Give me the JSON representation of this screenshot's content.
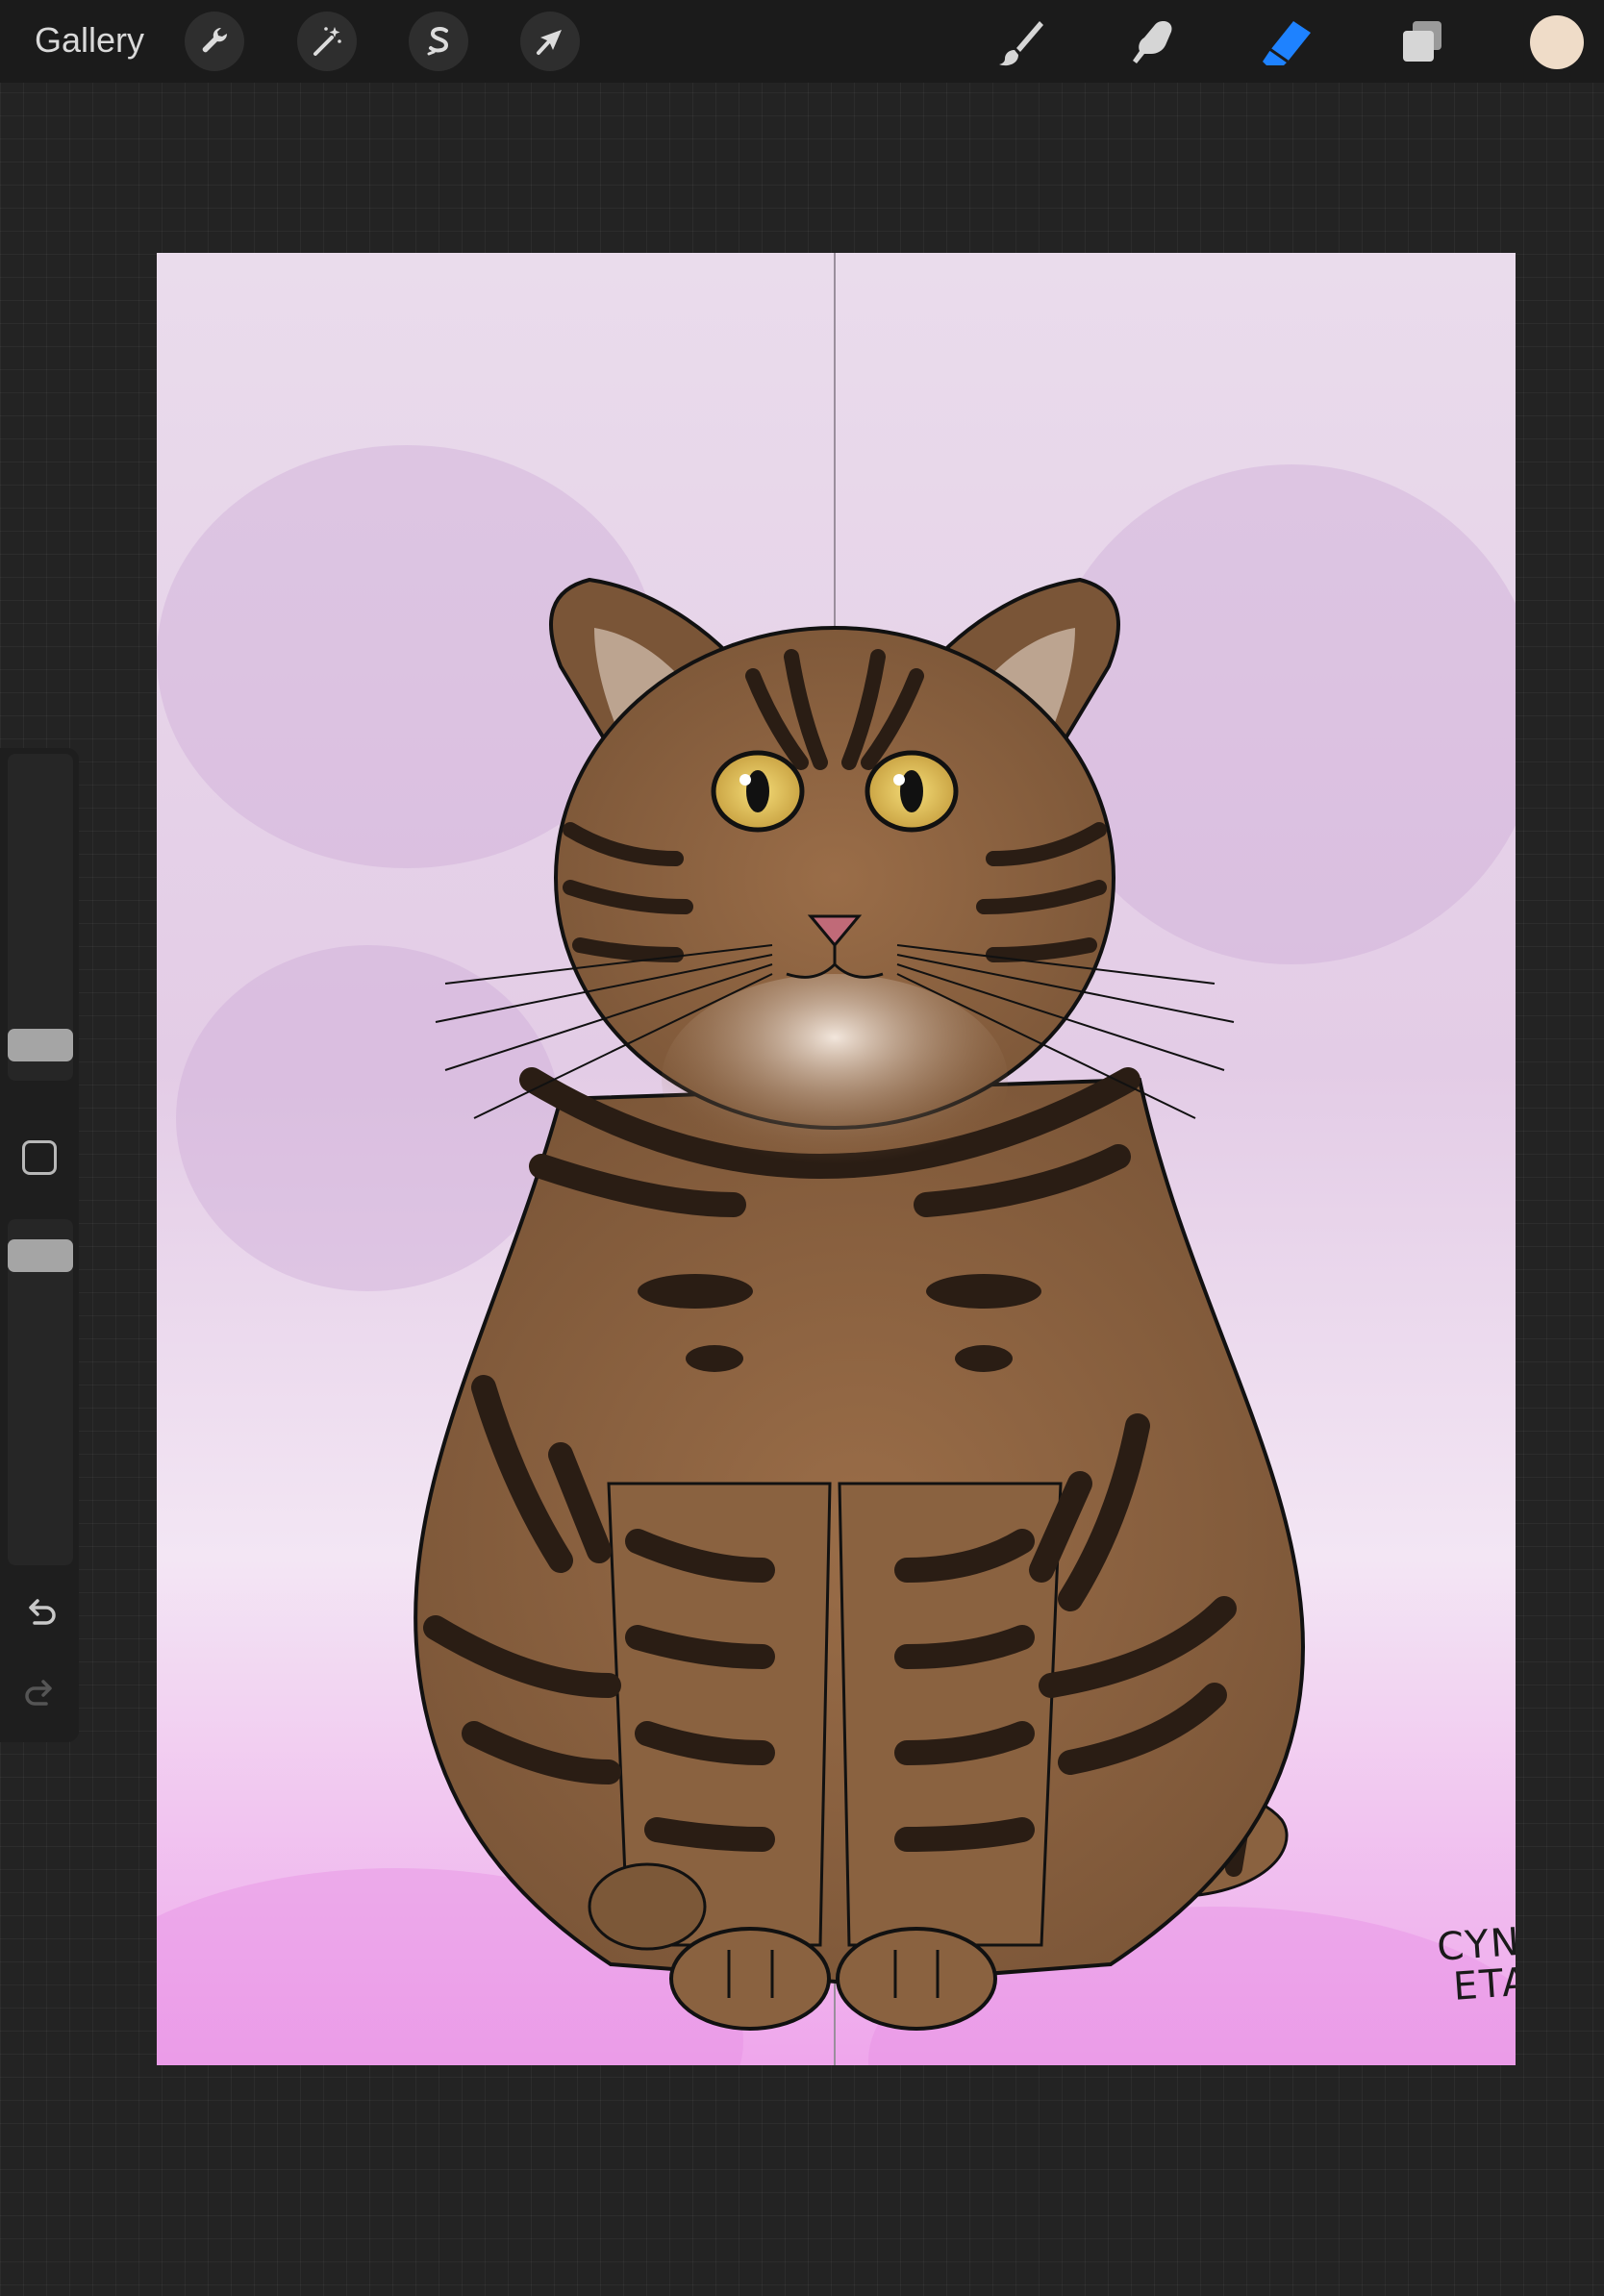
{
  "topbar": {
    "gallery_label": "Gallery",
    "left_tools": [
      {
        "name": "actions",
        "icon": "wrench-icon"
      },
      {
        "name": "adjustments",
        "icon": "magic-wand-icon"
      },
      {
        "name": "selection",
        "icon": "selection-s-icon"
      },
      {
        "name": "transform",
        "icon": "arrow-cursor-icon"
      }
    ],
    "right_tools": [
      {
        "name": "brush",
        "icon": "brush-icon",
        "active": false
      },
      {
        "name": "smudge",
        "icon": "smudge-finger-icon",
        "active": false
      },
      {
        "name": "eraser",
        "icon": "eraser-icon",
        "active": true
      },
      {
        "name": "layers",
        "icon": "layers-icon",
        "active": false
      }
    ],
    "current_color": "#efdcc8",
    "active_color": "#1e82ff"
  },
  "sidebar": {
    "brush_size_level": 0.2,
    "opacity_level": 0.85,
    "icons": [
      "square-modify-icon",
      "undo-icon",
      "redo-icon"
    ]
  },
  "artwork": {
    "subject": "tabby-cat-illustration",
    "signature_lines": [
      "CYNTHIA",
      "ETAL"
    ],
    "colors": {
      "background_top": "#e6d2e8",
      "background_bottom": "#f0a8ec",
      "fur": "#8a6240",
      "stripes": "#2a1d14",
      "eyes": "#e8c860",
      "nose": "#c06a78"
    }
  }
}
